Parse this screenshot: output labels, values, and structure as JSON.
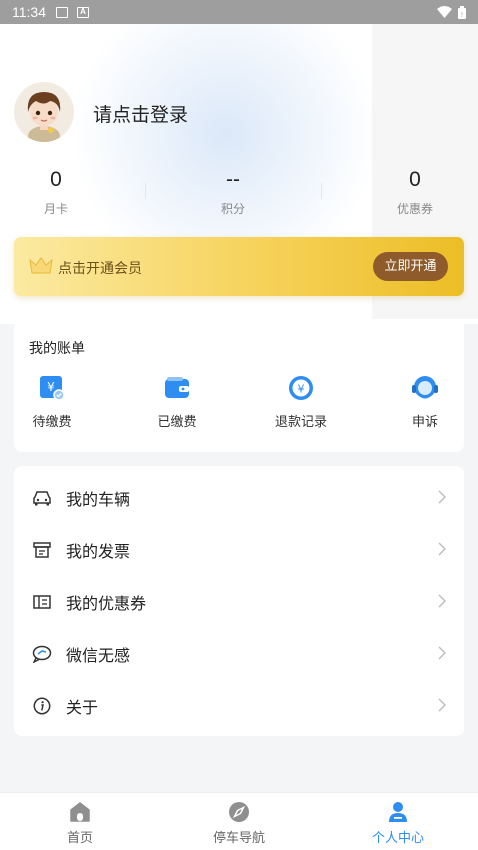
{
  "status_bar": {
    "time": "11:34",
    "notif_icons": [
      "image-icon",
      "a-letter-icon"
    ],
    "right_icons": [
      "wifi-icon",
      "battery-icon"
    ]
  },
  "profile": {
    "login_text": "请点击登录",
    "avatar_icon": "cartoon-avatar"
  },
  "stats": [
    {
      "value": "0",
      "label": "月卡"
    },
    {
      "value": "--",
      "label": "积分"
    },
    {
      "value": "0",
      "label": "优惠券"
    }
  ],
  "membership": {
    "text": "点击开通会员",
    "button": "立即开通",
    "icon": "crown-icon"
  },
  "bill": {
    "title": "我的账单",
    "items": [
      {
        "label": "待缴费",
        "icon": "pending-payment-icon"
      },
      {
        "label": "已缴费",
        "icon": "wallet-icon"
      },
      {
        "label": "退款记录",
        "icon": "refund-icon"
      },
      {
        "label": "申诉",
        "icon": "customer-service-icon"
      }
    ]
  },
  "menu": [
    {
      "label": "我的车辆",
      "icon": "car-icon"
    },
    {
      "label": "我的发票",
      "icon": "invoice-icon"
    },
    {
      "label": "我的优惠券",
      "icon": "coupon-icon"
    },
    {
      "label": "微信无感",
      "icon": "wechat-icon"
    },
    {
      "label": "关于",
      "icon": "info-icon"
    }
  ],
  "tabs": [
    {
      "label": "首页",
      "icon": "home-icon"
    },
    {
      "label": "停车导航",
      "icon": "compass-icon"
    },
    {
      "label": "个人中心",
      "icon": "person-icon",
      "active": true
    }
  ],
  "colors": {
    "accent": "#2d8df0",
    "gold_start": "#fbeaa2",
    "gold_end": "#ecbd25",
    "button_brown": "#8f5b2a"
  }
}
